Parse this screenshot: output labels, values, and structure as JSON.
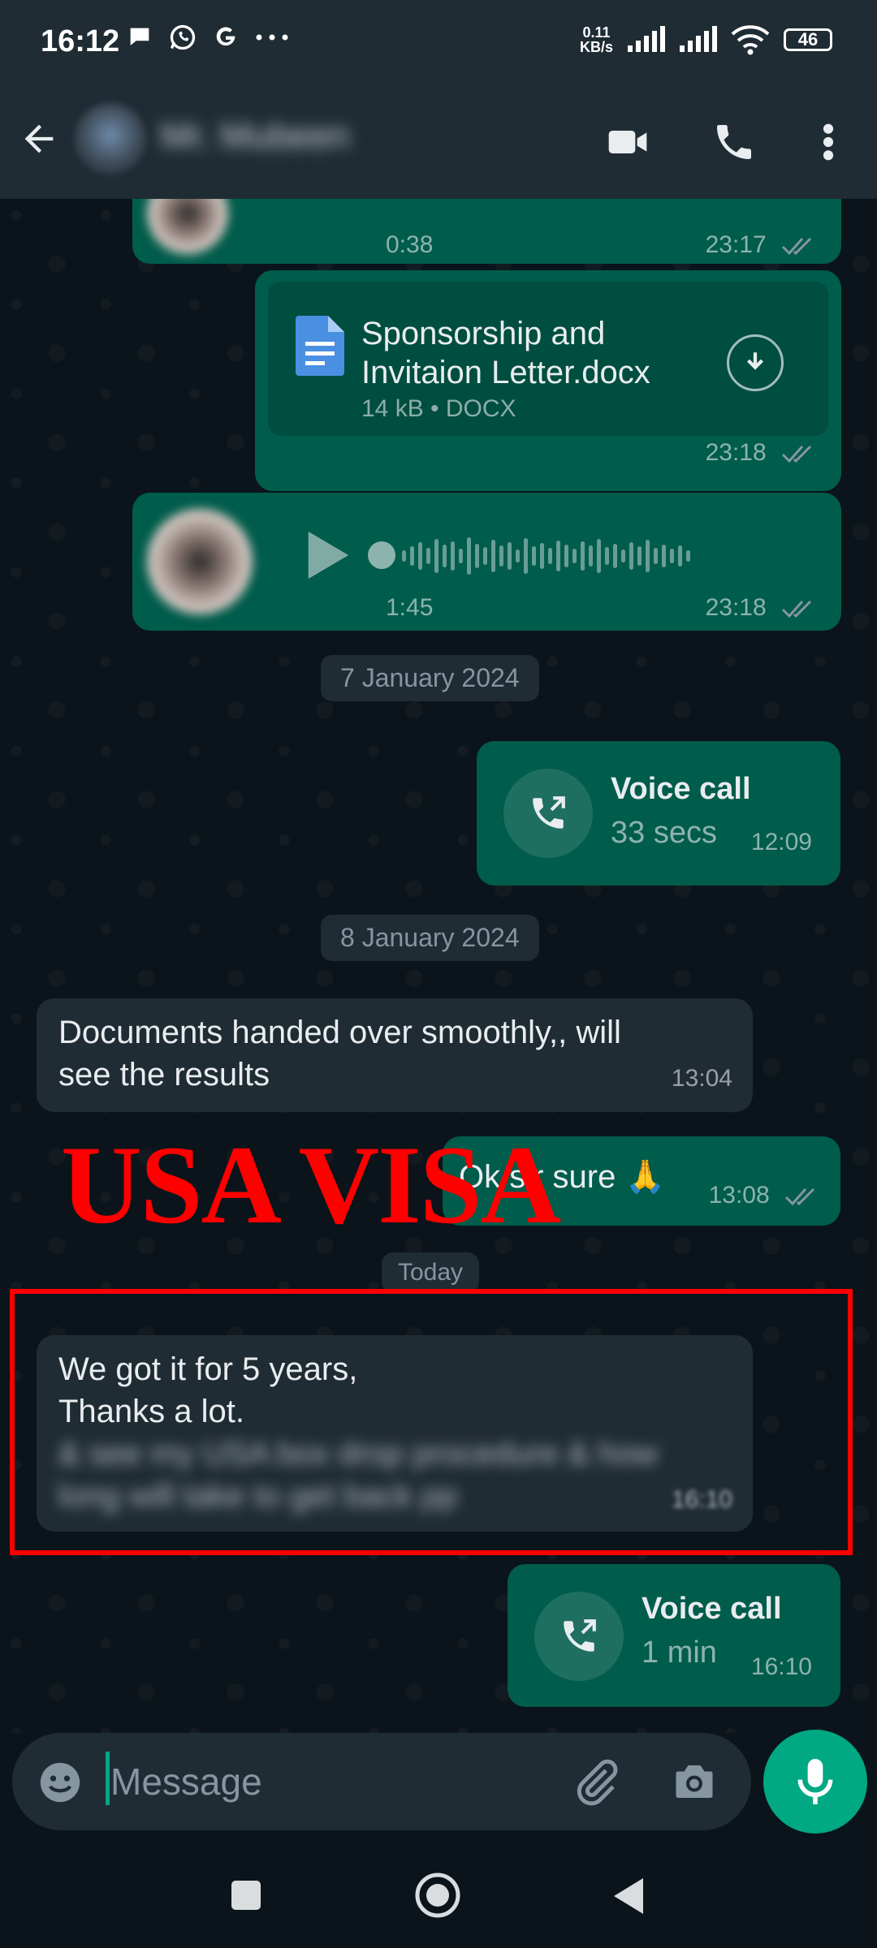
{
  "status_bar": {
    "time": "16:12",
    "net_speed_value": "0.11",
    "net_speed_unit": "KB/s",
    "battery": "46",
    "left_icons": [
      "chat-bubble-icon",
      "whatsapp-icon",
      "google-icon",
      "more-dots-icon"
    ],
    "right_icons": [
      "signal-icon",
      "signal-icon",
      "wifi-icon",
      "battery-icon"
    ]
  },
  "header": {
    "contact_name": "Mr. Mubeen",
    "icons": [
      "back-arrow-icon",
      "video-call-icon",
      "phone-icon",
      "more-vertical-icon"
    ]
  },
  "messages": {
    "voice1": {
      "duration": "0:38",
      "time": "23:17"
    },
    "document": {
      "name_line1": "Sponsorship and",
      "name_line2": "Invitaion Letter.docx",
      "meta": "14 kB • DOCX",
      "time": "23:18"
    },
    "voice2": {
      "duration": "1:45",
      "time": "23:18"
    },
    "date1": "7 January 2024",
    "call1": {
      "title": "Voice call",
      "duration": "33 secs",
      "time": "12:09"
    },
    "date2": "8 January 2024",
    "incoming1": {
      "line1": "Documents handed over smoothly,, will",
      "line2": "see the results",
      "time": "13:04"
    },
    "outgoing1": {
      "text": "Ok sir sure 🙏",
      "time": "13:08"
    },
    "date3": "Today",
    "incoming2": {
      "line1": "We got it for 5 years,",
      "line2": "Thanks a lot.",
      "line3": "& see my USA box drop procedure & how",
      "line4": "long will take to get back pp",
      "time": "16:10"
    },
    "call2": {
      "title": "Voice call",
      "duration": "1 min",
      "time": "16:10"
    }
  },
  "overlay": {
    "title": "USA VISA"
  },
  "composer": {
    "placeholder": "Message"
  },
  "colors": {
    "accent": "#00a884",
    "outgoing_bubble": "#005c4b",
    "incoming_bubble": "#202c33",
    "annotation_red": "#ff0000"
  }
}
